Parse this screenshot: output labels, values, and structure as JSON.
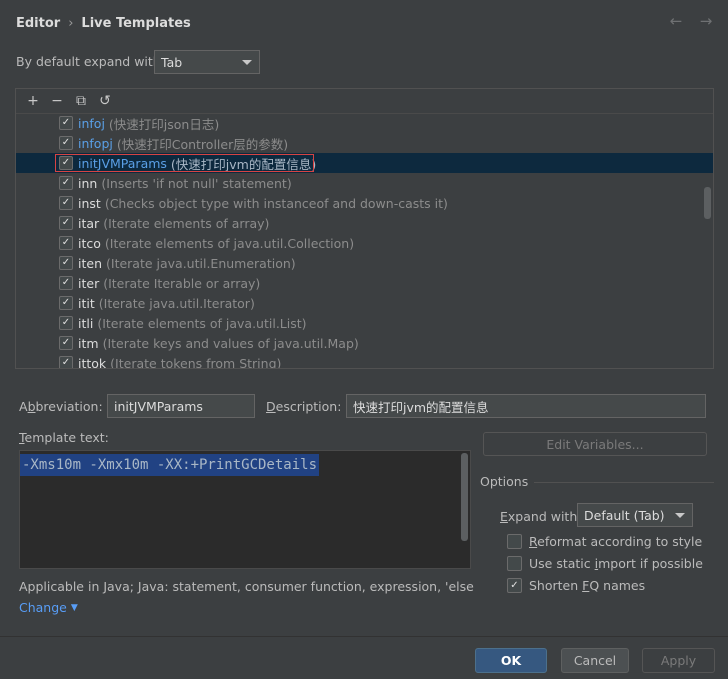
{
  "breadcrumb": {
    "parent": "Editor",
    "separator": "›",
    "current": "Live Templates"
  },
  "nav": {
    "back": "←",
    "forward": "→"
  },
  "expand_default": {
    "label": "By default expand with",
    "value": "Tab"
  },
  "toolbar": {
    "add": "+",
    "remove": "−",
    "copy": "⧉",
    "reset": "↺"
  },
  "templates": [
    {
      "abbr": "infoj",
      "desc": "(快速打印json日志)",
      "blue": true
    },
    {
      "abbr": "infopj",
      "desc": "(快速打印Controller层的参数)",
      "blue": true
    },
    {
      "abbr": "initJVMParams",
      "desc": "(快速打印jvm的配置信息)",
      "blue": true,
      "selected": true
    },
    {
      "abbr": "inn",
      "desc": "(Inserts 'if not null' statement)"
    },
    {
      "abbr": "inst",
      "desc": "(Checks object type with instanceof and down-casts it)"
    },
    {
      "abbr": "itar",
      "desc": "(Iterate elements of array)"
    },
    {
      "abbr": "itco",
      "desc": "(Iterate elements of java.util.Collection)"
    },
    {
      "abbr": "iten",
      "desc": "(Iterate java.util.Enumeration)"
    },
    {
      "abbr": "iter",
      "desc": "(Iterate Iterable or array)"
    },
    {
      "abbr": "itit",
      "desc": "(Iterate java.util.Iterator)"
    },
    {
      "abbr": "itli",
      "desc": "(Iterate elements of java.util.List)"
    },
    {
      "abbr": "itm",
      "desc": "(Iterate keys and values of java.util.Map)"
    },
    {
      "abbr": "ittok",
      "desc": "(Iterate tokens from String)"
    }
  ],
  "abbreviation": {
    "label": "Abbreviation:",
    "value": "initJVMParams"
  },
  "description": {
    "label": "Description:",
    "value": "快速打印jvm的配置信息"
  },
  "template_text": {
    "label": "Template text:",
    "value": "-Xms10m -Xmx10m -XX:+PrintGCDetails"
  },
  "edit_variables": "Edit Variables...",
  "options": {
    "title": "Options",
    "expand_label": "Expand with",
    "expand_value": "Default (Tab)",
    "reformat": "Reformat according to style",
    "static_import": "Use static import if possible",
    "shorten_fq": "Shorten FQ names",
    "reformat_checked": false,
    "static_import_checked": false,
    "shorten_fq_checked": true
  },
  "applicable": "Applicable in Java; Java: statement, consumer function, expression, 'else' po...",
  "change_link": "Change",
  "buttons": {
    "ok": "OK",
    "cancel": "Cancel",
    "apply": "Apply"
  }
}
